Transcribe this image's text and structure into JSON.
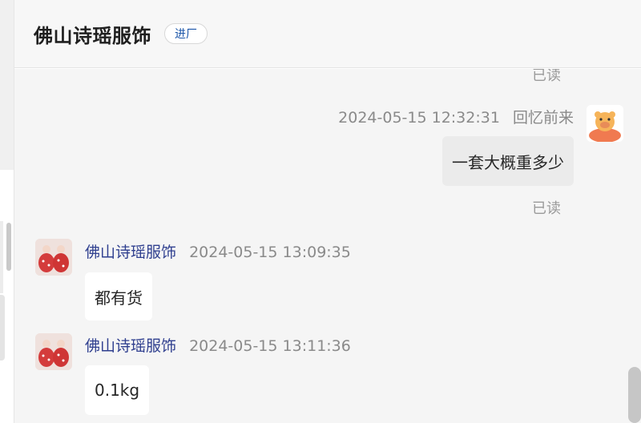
{
  "header": {
    "title": "佛山诗瑶服饰",
    "badge": "进厂"
  },
  "messages": [
    {
      "sender": "回忆前来",
      "timestamp": "2024-05-15 12:32:31",
      "text": "一套大概重多少",
      "status": "已读",
      "from_me": true
    },
    {
      "sender": "佛山诗瑶服饰",
      "timestamp": "2024-05-15 13:09:35",
      "text": "都有货",
      "from_me": false
    },
    {
      "sender": "佛山诗瑶服饰",
      "timestamp": "2024-05-15 13:11:36",
      "text": "0.1kg",
      "from_me": false
    }
  ],
  "previous_status": "已读",
  "colors": {
    "header_bg": "#f7f7f7",
    "chat_bg": "#f5f5f5",
    "sender_name": "#2f3f8f",
    "badge_text": "#1b55a8"
  }
}
